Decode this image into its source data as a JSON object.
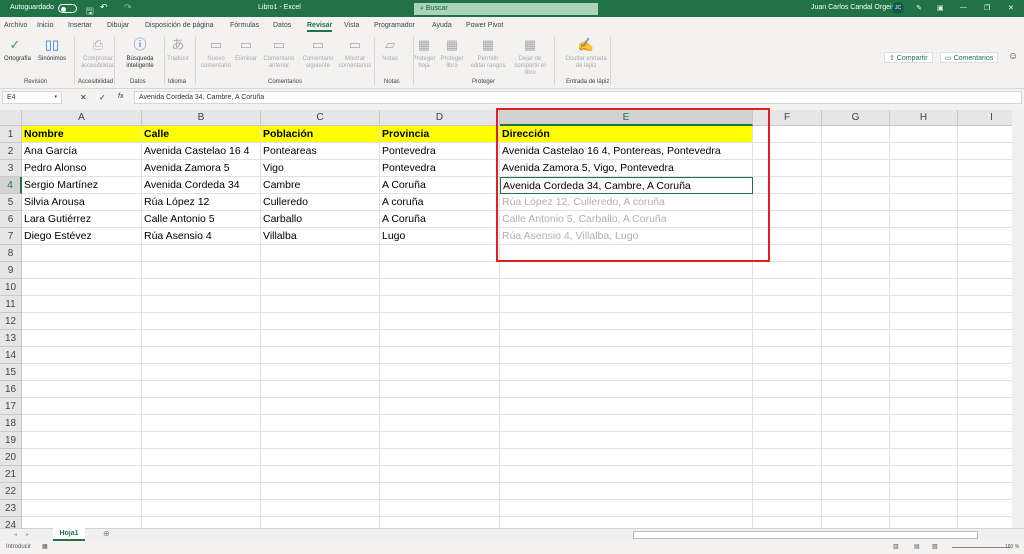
{
  "titlebar": {
    "autosave": "Autoguardado",
    "title": "Libro1 - Excel",
    "search": "Buscar",
    "user": "Juan Carlos Candal Orgeira",
    "initials": "JC"
  },
  "tabs": [
    "Archivo",
    "Inicio",
    "Insertar",
    "Dibujar",
    "Disposición de página",
    "Fórmulas",
    "Datos",
    "Revisar",
    "Vista",
    "Programador",
    "Ayuda",
    "Power Pivot"
  ],
  "active_tab": "Revisar",
  "share": "Compartir",
  "comments": "Comentarios",
  "ribbon": {
    "buttons": [
      "Ortografía",
      "Sinónimos",
      "Comprobar accesibilidad",
      "Búsqueda inteligente",
      "Traducir",
      "Nuevo comentario",
      "Eliminar",
      "Comentario anterior",
      "Comentario siguiente",
      "Mostrar comentarios",
      "Notas",
      "Proteger hoja",
      "Proteger libro",
      "Permitir editar rangos",
      "Dejar de compartir el libro",
      "Ocultar entrada de lápiz"
    ],
    "groups": [
      "Revisión",
      "Accesibilidad",
      "Datos",
      "Idioma",
      "Comentarios",
      "Notas",
      "Proteger",
      "Entrada de lápiz"
    ]
  },
  "formula_bar": {
    "name_box": "E4",
    "content": "Avenida Cordeda 34, Cambre, A Coruña"
  },
  "sheet": {
    "columns": [
      "A",
      "B",
      "C",
      "D",
      "E",
      "F",
      "G",
      "H",
      "I"
    ],
    "rows": [
      [
        "Nombre",
        "Calle",
        "Población",
        "Provincia",
        "Dirección"
      ],
      [
        "Ana García",
        "Avenida Castelao 16 4",
        "Ponteareas",
        "Pontevedra",
        "Avenida Castelao 16 4, Pontereas, Pontevedra"
      ],
      [
        "Pedro Alonso",
        "Avenida Zamora 5",
        "Vigo",
        "Pontevedra",
        "Avenida Zamora 5, Vigo, Pontevedra"
      ],
      [
        "Sergio Martínez",
        "Avenida Cordeda 34",
        "Cambre",
        "A Coruña",
        "Avenida Cordeda 34, Cambre, A Coruña"
      ],
      [
        "Silvia Arousa",
        "Rúa López 12",
        "Culleredo",
        "A coruña",
        "Rúa López 12, Culleredo, A coruña"
      ],
      [
        "Lara Gutiérrez",
        "Calle Antonio 5",
        "Carballo",
        "A Coruña",
        "Calle Antonio 5, Carballo, A Coruña"
      ],
      [
        "Diego Estévez",
        "Rúa Asensio 4",
        "Villalba",
        "Lugo",
        "Rúa Asensio 4, Villalba, Lugo"
      ]
    ],
    "row_count": 24,
    "selected_cell": "E4",
    "flash_fill_preview_rows": [
      5,
      6,
      7
    ],
    "header_fill": "#ffff00"
  },
  "sheet_tab": "Hoja1",
  "status": {
    "mode": "Introducir",
    "zoom": "160 %"
  }
}
